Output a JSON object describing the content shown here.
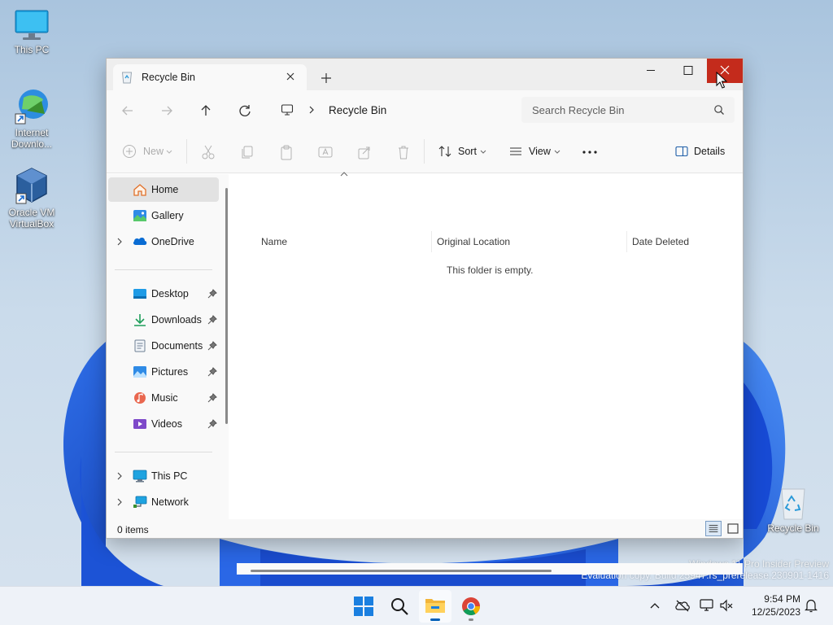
{
  "desktop": {
    "icons": [
      {
        "label": "This PC"
      },
      {
        "label": "Internet Downlo..."
      },
      {
        "label": "Oracle VM VirtualBox"
      },
      {
        "label": "Recycle Bin"
      }
    ],
    "watermark_line1": "Windows 11 Pro Insider Preview",
    "watermark_line2": "Evaluation copy. Build 25947.rs_prerelease.230901-1416"
  },
  "window": {
    "tab_title": "Recycle Bin",
    "address": {
      "crumb": "Recycle Bin"
    },
    "search": {
      "placeholder": "Search Recycle Bin"
    },
    "commands": {
      "new": "New",
      "sort": "Sort",
      "view": "View",
      "details": "Details"
    },
    "nav": {
      "home": "Home",
      "gallery": "Gallery",
      "onedrive": "OneDrive",
      "desktop": "Desktop",
      "downloads": "Downloads",
      "documents": "Documents",
      "pictures": "Pictures",
      "music": "Music",
      "videos": "Videos",
      "thispc": "This PC",
      "network": "Network"
    },
    "columns": {
      "name": "Name",
      "original_location": "Original Location",
      "date_deleted": "Date Deleted"
    },
    "empty_message": "This folder is empty.",
    "status": {
      "item_count": "0 items"
    }
  },
  "taskbar": {
    "time": "9:54 PM",
    "date": "12/25/2023"
  },
  "colors": {
    "accent": "#005fb8",
    "close_red": "#c42b1c"
  }
}
